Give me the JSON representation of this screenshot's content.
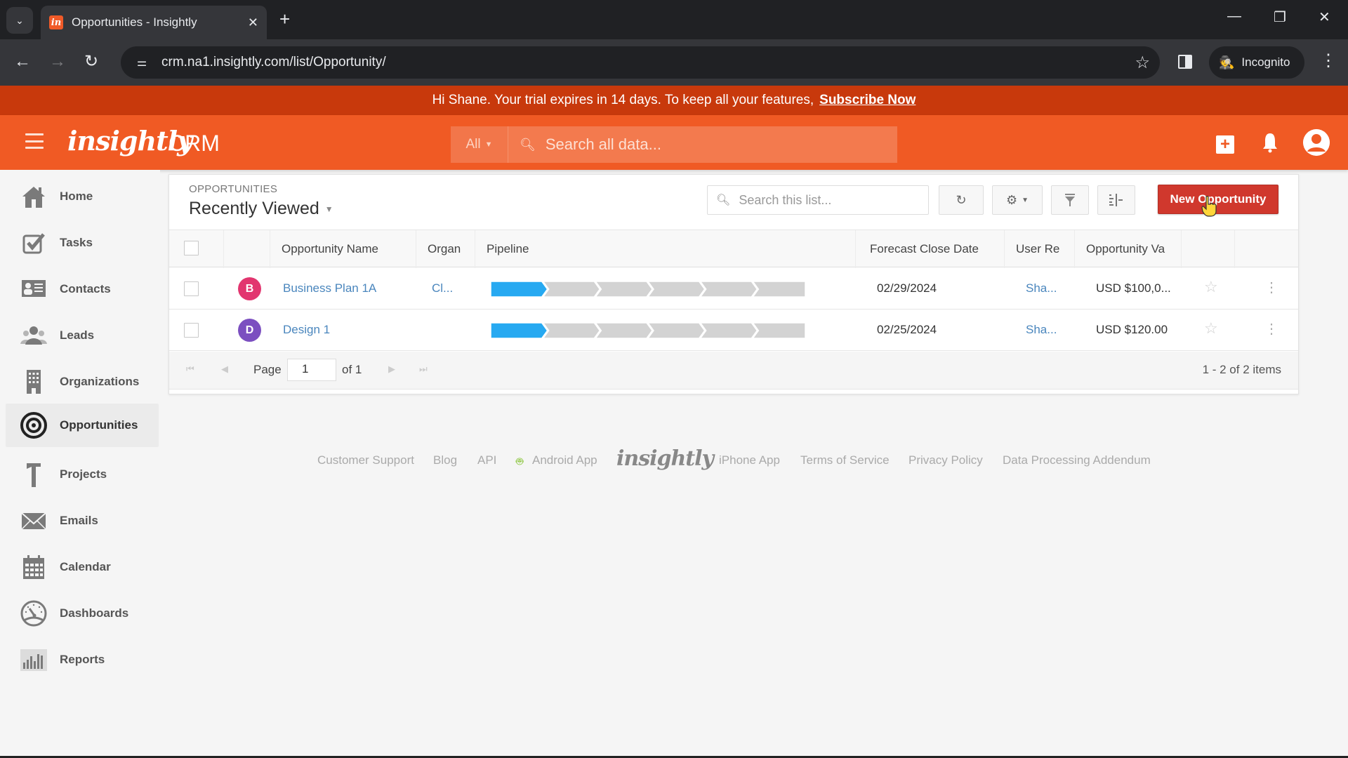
{
  "browser": {
    "tab_title": "Opportunities - Insightly",
    "favicon_letter": "in",
    "url": "crm.na1.insightly.com/list/Opportunity/",
    "incognito_label": "Incognito"
  },
  "banner": {
    "message": "Hi Shane. Your trial expires in 14 days. To keep all your features,",
    "cta": "Subscribe Now"
  },
  "header": {
    "logo": "insightly",
    "product": "CRM",
    "search_scope": "All",
    "search_placeholder": "Search all data..."
  },
  "sidebar": {
    "items": [
      {
        "label": "Home",
        "icon": "home-icon"
      },
      {
        "label": "Tasks",
        "icon": "tasks-icon"
      },
      {
        "label": "Contacts",
        "icon": "contacts-icon"
      },
      {
        "label": "Leads",
        "icon": "leads-icon"
      },
      {
        "label": "Organizations",
        "icon": "organizations-icon"
      },
      {
        "label": "Opportunities",
        "icon": "target-icon",
        "active": true
      },
      {
        "label": "Projects",
        "icon": "hammer-icon"
      },
      {
        "label": "Emails",
        "icon": "envelope-icon"
      },
      {
        "label": "Calendar",
        "icon": "calendar-icon"
      },
      {
        "label": "Dashboards",
        "icon": "gauge-icon"
      },
      {
        "label": "Reports",
        "icon": "bar-chart-icon"
      }
    ]
  },
  "list": {
    "breadcrumb": "OPPORTUNITIES",
    "view": "Recently Viewed",
    "search_placeholder": "Search this list...",
    "new_button": "New Opportunity",
    "columns": [
      "Opportunity Name",
      "Organ",
      "Pipeline",
      "Forecast Close Date",
      "User Re",
      "Opportunity Va"
    ],
    "rows": [
      {
        "initial": "B",
        "badge_color": "#e2356f",
        "name": "Business Plan 1A",
        "org": "Cl...",
        "pipeline_stage": 1,
        "pipeline_total": 6,
        "close_date": "02/29/2024",
        "user": "Sha...",
        "value": "USD $100,0..."
      },
      {
        "initial": "D",
        "badge_color": "#7b4fc0",
        "name": "Design 1",
        "org": "",
        "pipeline_stage": 1,
        "pipeline_total": 6,
        "close_date": "02/25/2024",
        "user": "Sha...",
        "value": "USD $120.00"
      }
    ],
    "pager": {
      "page_label": "Page",
      "page": "1",
      "of_label": "of 1",
      "summary": "1 - 2 of 2 items"
    }
  },
  "colors": {
    "brand": "#f05a24",
    "banner": "#c8390c",
    "primary_button": "#d0382d",
    "pipeline_active": "#27a9f1",
    "pipeline_inactive": "#d3d3d3",
    "link": "#4a86bd"
  },
  "footer": {
    "links": [
      "Customer Support",
      "Blog",
      "API",
      "Android App",
      "iPhone App",
      "Terms of Service",
      "Privacy Policy",
      "Data Processing Addendum"
    ],
    "logo": "insightly"
  }
}
